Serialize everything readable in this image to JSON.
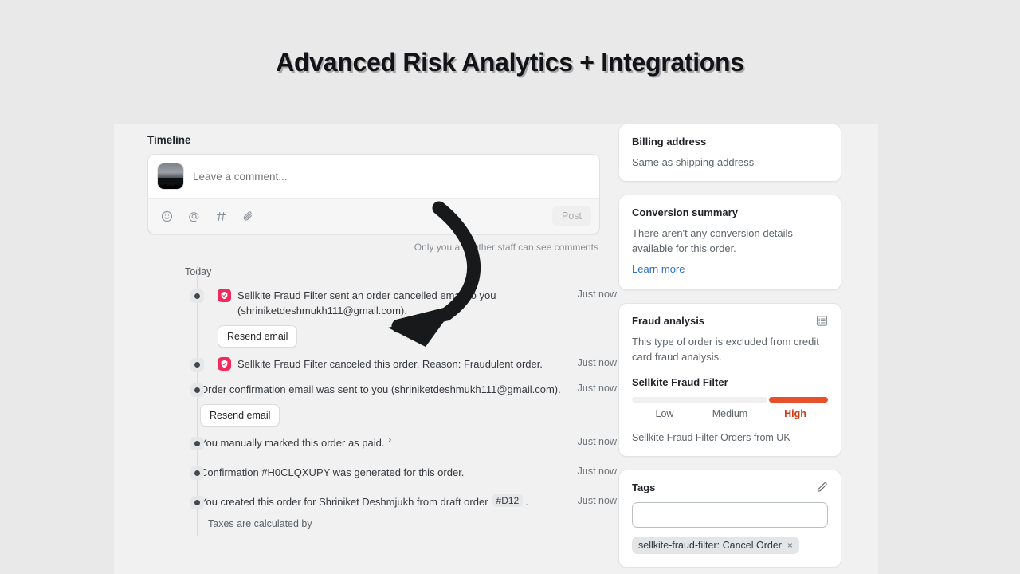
{
  "headline": "Advanced Risk Analytics + Integrations",
  "timeline": {
    "title": "Timeline",
    "composer": {
      "placeholder": "Leave a comment...",
      "value": "",
      "tools": [
        "emoji-icon",
        "mention-icon",
        "hashtag-icon",
        "attachment-icon"
      ],
      "post_label": "Post",
      "privacy_note": "Only you and other staff can see comments"
    },
    "day_label": "Today",
    "events": [
      {
        "badge": "sellkite-fraud-filter-icon",
        "text": "Sellkite Fraud Filter sent an order cancelled email to you (shriniketdeshmukh111@gmail.com).",
        "action_label": "Resend email",
        "timestamp": "Just now"
      },
      {
        "badge": "sellkite-fraud-filter-icon",
        "text": "Sellkite Fraud Filter canceled this order. Reason: Fraudulent order.",
        "action_label": "",
        "timestamp": "Just now"
      },
      {
        "badge": "",
        "text": "Order confirmation email was sent to you (shriniketdeshmukh111@gmail.com).",
        "action_label": "Resend email",
        "timestamp": "Just now"
      },
      {
        "badge": "",
        "text": "You manually marked this order as paid.",
        "chevron": "›",
        "action_label": "",
        "timestamp": "Just now"
      },
      {
        "badge": "",
        "text": "Confirmation #H0CLQXUPY was generated for this order.",
        "action_label": "",
        "timestamp": "Just now"
      },
      {
        "badge": "",
        "text_before": "You created this order for Shriniket Deshmjukh from draft order",
        "code_chip": "#D12",
        "text_after": ".",
        "sub_note": "Taxes are calculated by",
        "action_label": "",
        "timestamp": "Just now"
      }
    ]
  },
  "sidebar": {
    "billing": {
      "title": "Billing address",
      "text": "Same as shipping address"
    },
    "conversion": {
      "title": "Conversion summary",
      "text": "There aren't any conversion details available for this order.",
      "link": "Learn more"
    },
    "fraud": {
      "title": "Fraud analysis",
      "icon": "list-view-icon",
      "text": "This type of order is excluded from credit card fraud analysis.",
      "filter_title": "Sellkite Fraud Filter",
      "levels": [
        "Low",
        "Medium",
        "High"
      ],
      "active_level": "High",
      "fill_percent": 30,
      "fill_color": "#e8502a",
      "note": "Sellkite Fraud Filter Orders from UK"
    },
    "tags": {
      "title": "Tags",
      "edit_icon": "pencil-icon",
      "input_value": "",
      "chips": [
        {
          "label": "sellkite-fraud-filter: Cancel Order",
          "remove": "×"
        }
      ]
    }
  }
}
